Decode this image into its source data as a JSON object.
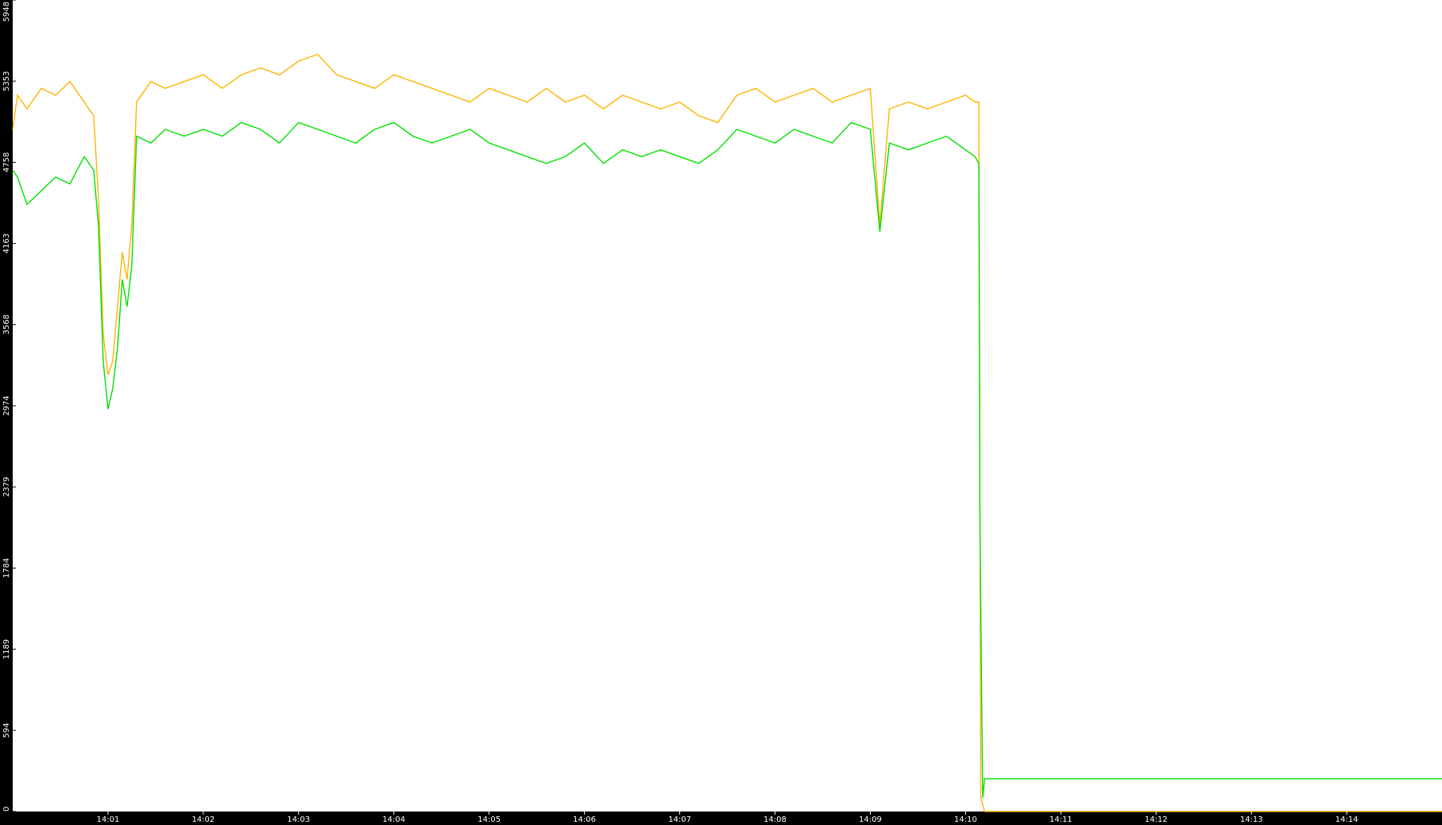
{
  "chart_data": {
    "type": "line",
    "title": "",
    "xlabel": "",
    "ylabel": "",
    "ylim": [
      0,
      5948
    ],
    "y_ticks": [
      "0",
      "594",
      "1189",
      "1784",
      "2379",
      "2974",
      "3568",
      "4163",
      "4758",
      "5353",
      "5948"
    ],
    "x_ticks": [
      "14:01",
      "14:02",
      "14:03",
      "14:04",
      "14:05",
      "14:06",
      "14:07",
      "14:08",
      "14:09",
      "14:10",
      "14:11",
      "14:12",
      "14:13",
      "14:14"
    ],
    "xlim_minutes": [
      0,
      15.0
    ],
    "grid": false,
    "legend": "none",
    "colors": {
      "plot_background": "#ffffff",
      "frame": "#000000",
      "axis_text": "#ffffff"
    },
    "series": [
      {
        "color": "#ffb300",
        "points": [
          [
            0,
            5000
          ],
          [
            0.05,
            5250
          ],
          [
            0.15,
            5150
          ],
          [
            0.3,
            5300
          ],
          [
            0.45,
            5250
          ],
          [
            0.6,
            5350
          ],
          [
            0.75,
            5200
          ],
          [
            0.85,
            5100
          ],
          [
            0.9,
            4500
          ],
          [
            0.95,
            3500
          ],
          [
            1.0,
            3200
          ],
          [
            1.05,
            3300
          ],
          [
            1.1,
            3700
          ],
          [
            1.15,
            4100
          ],
          [
            1.2,
            3900
          ],
          [
            1.25,
            4300
          ],
          [
            1.3,
            5200
          ],
          [
            1.45,
            5350
          ],
          [
            1.6,
            5300
          ],
          [
            1.8,
            5350
          ],
          [
            2.0,
            5400
          ],
          [
            2.2,
            5300
          ],
          [
            2.4,
            5400
          ],
          [
            2.6,
            5450
          ],
          [
            2.8,
            5400
          ],
          [
            3.0,
            5500
          ],
          [
            3.2,
            5550
          ],
          [
            3.4,
            5400
          ],
          [
            3.6,
            5350
          ],
          [
            3.8,
            5300
          ],
          [
            4.0,
            5400
          ],
          [
            4.2,
            5350
          ],
          [
            4.4,
            5300
          ],
          [
            4.6,
            5250
          ],
          [
            4.8,
            5200
          ],
          [
            5.0,
            5300
          ],
          [
            5.2,
            5250
          ],
          [
            5.4,
            5200
          ],
          [
            5.6,
            5300
          ],
          [
            5.8,
            5200
          ],
          [
            6.0,
            5250
          ],
          [
            6.2,
            5150
          ],
          [
            6.4,
            5250
          ],
          [
            6.6,
            5200
          ],
          [
            6.8,
            5150
          ],
          [
            7.0,
            5200
          ],
          [
            7.2,
            5100
          ],
          [
            7.4,
            5050
          ],
          [
            7.6,
            5250
          ],
          [
            7.8,
            5300
          ],
          [
            8.0,
            5200
          ],
          [
            8.2,
            5250
          ],
          [
            8.4,
            5300
          ],
          [
            8.6,
            5200
          ],
          [
            8.8,
            5250
          ],
          [
            9.0,
            5300
          ],
          [
            9.1,
            4300
          ],
          [
            9.2,
            5150
          ],
          [
            9.4,
            5200
          ],
          [
            9.6,
            5150
          ],
          [
            9.8,
            5200
          ],
          [
            10.0,
            5250
          ],
          [
            10.1,
            5200
          ],
          [
            10.14,
            5200
          ],
          [
            10.16,
            100
          ],
          [
            10.2,
            0
          ],
          [
            15.0,
            0
          ]
        ]
      },
      {
        "color": "#00e000",
        "points": [
          [
            0,
            4700
          ],
          [
            0.05,
            4650
          ],
          [
            0.15,
            4450
          ],
          [
            0.3,
            4550
          ],
          [
            0.45,
            4650
          ],
          [
            0.6,
            4600
          ],
          [
            0.75,
            4800
          ],
          [
            0.85,
            4700
          ],
          [
            0.9,
            4300
          ],
          [
            0.95,
            3300
          ],
          [
            1.0,
            2950
          ],
          [
            1.05,
            3100
          ],
          [
            1.1,
            3400
          ],
          [
            1.15,
            3900
          ],
          [
            1.2,
            3700
          ],
          [
            1.25,
            4000
          ],
          [
            1.3,
            4950
          ],
          [
            1.45,
            4900
          ],
          [
            1.6,
            5000
          ],
          [
            1.8,
            4950
          ],
          [
            2.0,
            5000
          ],
          [
            2.2,
            4950
          ],
          [
            2.4,
            5050
          ],
          [
            2.6,
            5000
          ],
          [
            2.8,
            4900
          ],
          [
            3.0,
            5050
          ],
          [
            3.2,
            5000
          ],
          [
            3.4,
            4950
          ],
          [
            3.6,
            4900
          ],
          [
            3.8,
            5000
          ],
          [
            4.0,
            5050
          ],
          [
            4.2,
            4950
          ],
          [
            4.4,
            4900
          ],
          [
            4.6,
            4950
          ],
          [
            4.8,
            5000
          ],
          [
            5.0,
            4900
          ],
          [
            5.2,
            4850
          ],
          [
            5.4,
            4800
          ],
          [
            5.6,
            4750
          ],
          [
            5.8,
            4800
          ],
          [
            6.0,
            4900
          ],
          [
            6.2,
            4750
          ],
          [
            6.4,
            4850
          ],
          [
            6.6,
            4800
          ],
          [
            6.8,
            4850
          ],
          [
            7.0,
            4800
          ],
          [
            7.2,
            4750
          ],
          [
            7.4,
            4850
          ],
          [
            7.6,
            5000
          ],
          [
            7.8,
            4950
          ],
          [
            8.0,
            4900
          ],
          [
            8.2,
            5000
          ],
          [
            8.4,
            4950
          ],
          [
            8.6,
            4900
          ],
          [
            8.8,
            5050
          ],
          [
            9.0,
            5000
          ],
          [
            9.1,
            4250
          ],
          [
            9.2,
            4900
          ],
          [
            9.4,
            4850
          ],
          [
            9.6,
            4900
          ],
          [
            9.8,
            4950
          ],
          [
            10.0,
            4850
          ],
          [
            10.1,
            4800
          ],
          [
            10.14,
            4750
          ],
          [
            10.15,
            2200
          ],
          [
            10.18,
            100
          ],
          [
            10.2,
            240
          ],
          [
            15.0,
            240
          ]
        ]
      }
    ]
  }
}
